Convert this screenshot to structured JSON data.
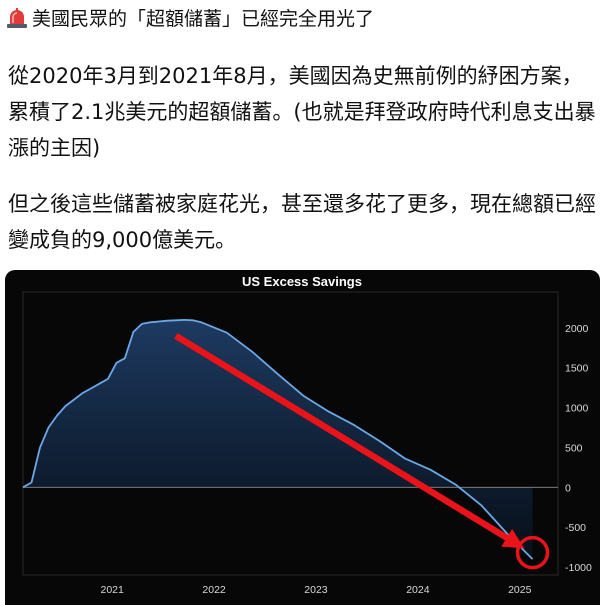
{
  "post": {
    "icon": "siren-icon",
    "title": "美國民眾的「超額儲蓄」已經完全用光了",
    "paragraph_1": "從2020年3月到2021年8月，美國因為史無前例的紓困方案，累積了2.1兆美元的超額儲蓄。(也就是拜登政府時代利息支出暴漲的主因)",
    "paragraph_2": "但之後這些儲蓄被家庭花光，甚至還多花了更多，現在總額已經變成負的9,000億美元。"
  },
  "colors": {
    "background": "#070707",
    "line": "#6aa8e8",
    "arrow": "#e8141a",
    "circle": "#e8141a"
  },
  "chart_data": {
    "type": "area",
    "title": "US Excess Savings",
    "xlabel": "",
    "ylabel": "",
    "x_ticks": [
      "2021",
      "2022",
      "2023",
      "2024",
      "2025"
    ],
    "y_ticks": [
      "2000",
      "1500",
      "1000",
      "500",
      "0",
      "-500",
      "-1000"
    ],
    "ylim": [
      -1000,
      2000
    ],
    "y_axis_position": "right",
    "grid": false,
    "series": [
      {
        "x": [
          "2020-03",
          "2020-04",
          "2020-05",
          "2020-06",
          "2020-07",
          "2020-08",
          "2020-09",
          "2020-10",
          "2020-11",
          "2020-12",
          "2021-01",
          "2021-02",
          "2021-03",
          "2021-04",
          "2021-05",
          "2021-06",
          "2021-07",
          "2021-08",
          "2021-09",
          "2021-10",
          "2021-11",
          "2021-12",
          "2022-03",
          "2022-06",
          "2022-09",
          "2022-12",
          "2023-03",
          "2023-06",
          "2023-09",
          "2023-12",
          "2024-03",
          "2024-06",
          "2024-09",
          "2024-12",
          "2025-03"
        ],
        "y": [
          0,
          60,
          500,
          750,
          900,
          1020,
          1100,
          1180,
          1240,
          1300,
          1360,
          1560,
          1620,
          1950,
          2050,
          2070,
          2080,
          2090,
          2095,
          2100,
          2095,
          2070,
          1940,
          1700,
          1420,
          1150,
          950,
          780,
          580,
          360,
          220,
          30,
          -230,
          -580,
          -900
        ]
      }
    ],
    "annotations": [
      {
        "type": "arrow",
        "from": [
          "2021-09",
          1900
        ],
        "to": [
          "2025-01",
          -700
        ]
      },
      {
        "type": "circle",
        "at": [
          "2025-03",
          -820
        ]
      }
    ]
  }
}
